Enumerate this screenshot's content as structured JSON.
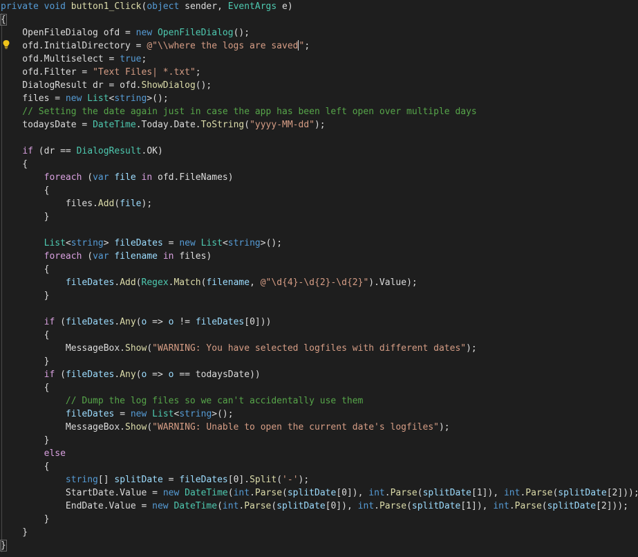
{
  "editor": {
    "lines": [
      [
        {
          "t": "private void ",
          "c": "kw"
        },
        {
          "t": "button1_Click",
          "c": "mth"
        },
        {
          "t": "(",
          "c": "txt"
        },
        {
          "t": "object",
          "c": "kw"
        },
        {
          "t": " sender, ",
          "c": "txt"
        },
        {
          "t": "EventArgs",
          "c": "type"
        },
        {
          "t": " e)",
          "c": "txt"
        }
      ],
      [
        {
          "t": "{",
          "c": "txt"
        }
      ],
      [
        {
          "t": "    OpenFileDialog ofd = ",
          "c": "txt"
        },
        {
          "t": "new",
          "c": "kw"
        },
        {
          "t": " ",
          "c": "txt"
        },
        {
          "t": "OpenFileDialog",
          "c": "type"
        },
        {
          "t": "();",
          "c": "txt"
        }
      ],
      [
        {
          "t": "    ofd.InitialDirectory = ",
          "c": "txt"
        },
        {
          "t": "@\"\\\\where the logs are saved",
          "c": "str"
        },
        {
          "t": "CARET",
          "c": "caret"
        },
        {
          "t": "\"",
          "c": "str"
        },
        {
          "t": ";",
          "c": "txt"
        }
      ],
      [
        {
          "t": "    ofd.Multiselect = ",
          "c": "txt"
        },
        {
          "t": "true",
          "c": "kw"
        },
        {
          "t": ";",
          "c": "txt"
        }
      ],
      [
        {
          "t": "    ofd.Filter = ",
          "c": "txt"
        },
        {
          "t": "\"Text Files| *.txt\"",
          "c": "str"
        },
        {
          "t": ";",
          "c": "txt"
        }
      ],
      [
        {
          "t": "    DialogResult dr = ofd.",
          "c": "txt"
        },
        {
          "t": "ShowDialog",
          "c": "mth"
        },
        {
          "t": "();",
          "c": "txt"
        }
      ],
      [
        {
          "t": "    files = ",
          "c": "txt"
        },
        {
          "t": "new",
          "c": "kw"
        },
        {
          "t": " ",
          "c": "txt"
        },
        {
          "t": "List",
          "c": "type"
        },
        {
          "t": "<",
          "c": "txt"
        },
        {
          "t": "string",
          "c": "kw"
        },
        {
          "t": ">();",
          "c": "txt"
        }
      ],
      [
        {
          "t": "    // Setting the date again just in case the app has been left open over multiple days",
          "c": "cmt"
        }
      ],
      [
        {
          "t": "    todaysDate = ",
          "c": "txt"
        },
        {
          "t": "DateTime",
          "c": "type"
        },
        {
          "t": ".Today.Date.",
          "c": "txt"
        },
        {
          "t": "ToString",
          "c": "mth"
        },
        {
          "t": "(",
          "c": "txt"
        },
        {
          "t": "\"yyyy-MM-dd\"",
          "c": "str"
        },
        {
          "t": ");",
          "c": "txt"
        }
      ],
      [],
      [
        {
          "t": "    ",
          "c": "txt"
        },
        {
          "t": "if",
          "c": "ctl"
        },
        {
          "t": " (dr == ",
          "c": "txt"
        },
        {
          "t": "DialogResult",
          "c": "type"
        },
        {
          "t": ".OK)",
          "c": "txt"
        }
      ],
      [
        {
          "t": "    {",
          "c": "txt"
        }
      ],
      [
        {
          "t": "        ",
          "c": "txt"
        },
        {
          "t": "foreach",
          "c": "ctl"
        },
        {
          "t": " (",
          "c": "txt"
        },
        {
          "t": "var",
          "c": "kw"
        },
        {
          "t": " ",
          "c": "txt"
        },
        {
          "t": "file",
          "c": "var"
        },
        {
          "t": " ",
          "c": "txt"
        },
        {
          "t": "in",
          "c": "ctl"
        },
        {
          "t": " ofd.FileNames)",
          "c": "txt"
        }
      ],
      [
        {
          "t": "        {",
          "c": "txt"
        }
      ],
      [
        {
          "t": "            files.",
          "c": "txt"
        },
        {
          "t": "Add",
          "c": "mth"
        },
        {
          "t": "(",
          "c": "txt"
        },
        {
          "t": "file",
          "c": "var"
        },
        {
          "t": ");",
          "c": "txt"
        }
      ],
      [
        {
          "t": "        }",
          "c": "txt"
        }
      ],
      [],
      [
        {
          "t": "        ",
          "c": "txt"
        },
        {
          "t": "List",
          "c": "type"
        },
        {
          "t": "<",
          "c": "txt"
        },
        {
          "t": "string",
          "c": "kw"
        },
        {
          "t": "> ",
          "c": "txt"
        },
        {
          "t": "fileDates",
          "c": "var"
        },
        {
          "t": " = ",
          "c": "txt"
        },
        {
          "t": "new",
          "c": "kw"
        },
        {
          "t": " ",
          "c": "txt"
        },
        {
          "t": "List",
          "c": "type"
        },
        {
          "t": "<",
          "c": "txt"
        },
        {
          "t": "string",
          "c": "kw"
        },
        {
          "t": ">();",
          "c": "txt"
        }
      ],
      [
        {
          "t": "        ",
          "c": "txt"
        },
        {
          "t": "foreach",
          "c": "ctl"
        },
        {
          "t": " (",
          "c": "txt"
        },
        {
          "t": "var",
          "c": "kw"
        },
        {
          "t": " ",
          "c": "txt"
        },
        {
          "t": "filename",
          "c": "var"
        },
        {
          "t": " ",
          "c": "txt"
        },
        {
          "t": "in",
          "c": "ctl"
        },
        {
          "t": " files)",
          "c": "txt"
        }
      ],
      [
        {
          "t": "        {",
          "c": "txt"
        }
      ],
      [
        {
          "t": "            ",
          "c": "txt"
        },
        {
          "t": "fileDates",
          "c": "var"
        },
        {
          "t": ".",
          "c": "txt"
        },
        {
          "t": "Add",
          "c": "mth"
        },
        {
          "t": "(",
          "c": "txt"
        },
        {
          "t": "Regex",
          "c": "type"
        },
        {
          "t": ".",
          "c": "txt"
        },
        {
          "t": "Match",
          "c": "mth"
        },
        {
          "t": "(",
          "c": "txt"
        },
        {
          "t": "filename",
          "c": "var"
        },
        {
          "t": ", ",
          "c": "txt"
        },
        {
          "t": "@\"\\d{4}-\\d{2}-\\d{2}\"",
          "c": "str"
        },
        {
          "t": ").Value);",
          "c": "txt"
        }
      ],
      [
        {
          "t": "        }",
          "c": "txt"
        }
      ],
      [],
      [
        {
          "t": "        ",
          "c": "txt"
        },
        {
          "t": "if",
          "c": "ctl"
        },
        {
          "t": " (",
          "c": "txt"
        },
        {
          "t": "fileDates",
          "c": "var"
        },
        {
          "t": ".",
          "c": "txt"
        },
        {
          "t": "Any",
          "c": "mth"
        },
        {
          "t": "(",
          "c": "txt"
        },
        {
          "t": "o",
          "c": "var"
        },
        {
          "t": " => ",
          "c": "txt"
        },
        {
          "t": "o",
          "c": "var"
        },
        {
          "t": " != ",
          "c": "txt"
        },
        {
          "t": "fileDates",
          "c": "var"
        },
        {
          "t": "[0]))",
          "c": "txt"
        }
      ],
      [
        {
          "t": "        {",
          "c": "txt"
        }
      ],
      [
        {
          "t": "            MessageBox.",
          "c": "txt"
        },
        {
          "t": "Show",
          "c": "mth"
        },
        {
          "t": "(",
          "c": "txt"
        },
        {
          "t": "\"WARNING: You have selected logfiles with different dates\"",
          "c": "str"
        },
        {
          "t": ");",
          "c": "txt"
        }
      ],
      [
        {
          "t": "        }",
          "c": "txt"
        }
      ],
      [
        {
          "t": "        ",
          "c": "txt"
        },
        {
          "t": "if",
          "c": "ctl"
        },
        {
          "t": " (",
          "c": "txt"
        },
        {
          "t": "fileDates",
          "c": "var"
        },
        {
          "t": ".",
          "c": "txt"
        },
        {
          "t": "Any",
          "c": "mth"
        },
        {
          "t": "(",
          "c": "txt"
        },
        {
          "t": "o",
          "c": "var"
        },
        {
          "t": " => ",
          "c": "txt"
        },
        {
          "t": "o",
          "c": "var"
        },
        {
          "t": " == todaysDate))",
          "c": "txt"
        }
      ],
      [
        {
          "t": "        {",
          "c": "txt"
        }
      ],
      [
        {
          "t": "            // Dump the log files so we can't accidentally use them",
          "c": "cmt"
        }
      ],
      [
        {
          "t": "            ",
          "c": "txt"
        },
        {
          "t": "fileDates",
          "c": "var"
        },
        {
          "t": " = ",
          "c": "txt"
        },
        {
          "t": "new",
          "c": "kw"
        },
        {
          "t": " ",
          "c": "txt"
        },
        {
          "t": "List",
          "c": "type"
        },
        {
          "t": "<",
          "c": "txt"
        },
        {
          "t": "string",
          "c": "kw"
        },
        {
          "t": ">();",
          "c": "txt"
        }
      ],
      [
        {
          "t": "            MessageBox.",
          "c": "txt"
        },
        {
          "t": "Show",
          "c": "mth"
        },
        {
          "t": "(",
          "c": "txt"
        },
        {
          "t": "\"WARNING: Unable to open the current date's logfiles\"",
          "c": "str"
        },
        {
          "t": ");",
          "c": "txt"
        }
      ],
      [
        {
          "t": "        }",
          "c": "txt"
        }
      ],
      [
        {
          "t": "        ",
          "c": "txt"
        },
        {
          "t": "else",
          "c": "ctl"
        }
      ],
      [
        {
          "t": "        {",
          "c": "txt"
        }
      ],
      [
        {
          "t": "            ",
          "c": "txt"
        },
        {
          "t": "string",
          "c": "kw"
        },
        {
          "t": "[] ",
          "c": "txt"
        },
        {
          "t": "splitDate",
          "c": "var"
        },
        {
          "t": " = ",
          "c": "txt"
        },
        {
          "t": "fileDates",
          "c": "var"
        },
        {
          "t": "[0].",
          "c": "txt"
        },
        {
          "t": "Split",
          "c": "mth"
        },
        {
          "t": "(",
          "c": "txt"
        },
        {
          "t": "'-'",
          "c": "str"
        },
        {
          "t": ");",
          "c": "txt"
        }
      ],
      [
        {
          "t": "            StartDate.Value = ",
          "c": "txt"
        },
        {
          "t": "new",
          "c": "kw"
        },
        {
          "t": " ",
          "c": "txt"
        },
        {
          "t": "DateTime",
          "c": "type"
        },
        {
          "t": "(",
          "c": "txt"
        },
        {
          "t": "int",
          "c": "kw"
        },
        {
          "t": ".",
          "c": "txt"
        },
        {
          "t": "Parse",
          "c": "mth"
        },
        {
          "t": "(",
          "c": "txt"
        },
        {
          "t": "splitDate",
          "c": "var"
        },
        {
          "t": "[0]), ",
          "c": "txt"
        },
        {
          "t": "int",
          "c": "kw"
        },
        {
          "t": ".",
          "c": "txt"
        },
        {
          "t": "Parse",
          "c": "mth"
        },
        {
          "t": "(",
          "c": "txt"
        },
        {
          "t": "splitDate",
          "c": "var"
        },
        {
          "t": "[1]), ",
          "c": "txt"
        },
        {
          "t": "int",
          "c": "kw"
        },
        {
          "t": ".",
          "c": "txt"
        },
        {
          "t": "Parse",
          "c": "mth"
        },
        {
          "t": "(",
          "c": "txt"
        },
        {
          "t": "splitDate",
          "c": "var"
        },
        {
          "t": "[2]));",
          "c": "txt"
        }
      ],
      [
        {
          "t": "            EndDate.Value = ",
          "c": "txt"
        },
        {
          "t": "new",
          "c": "kw"
        },
        {
          "t": " ",
          "c": "txt"
        },
        {
          "t": "DateTime",
          "c": "type"
        },
        {
          "t": "(",
          "c": "txt"
        },
        {
          "t": "int",
          "c": "kw"
        },
        {
          "t": ".",
          "c": "txt"
        },
        {
          "t": "Parse",
          "c": "mth"
        },
        {
          "t": "(",
          "c": "txt"
        },
        {
          "t": "splitDate",
          "c": "var"
        },
        {
          "t": "[0]), ",
          "c": "txt"
        },
        {
          "t": "int",
          "c": "kw"
        },
        {
          "t": ".",
          "c": "txt"
        },
        {
          "t": "Parse",
          "c": "mth"
        },
        {
          "t": "(",
          "c": "txt"
        },
        {
          "t": "splitDate",
          "c": "var"
        },
        {
          "t": "[1]), ",
          "c": "txt"
        },
        {
          "t": "int",
          "c": "kw"
        },
        {
          "t": ".",
          "c": "txt"
        },
        {
          "t": "Parse",
          "c": "mth"
        },
        {
          "t": "(",
          "c": "txt"
        },
        {
          "t": "splitDate",
          "c": "var"
        },
        {
          "t": "[2]));",
          "c": "txt"
        }
      ],
      [
        {
          "t": "        }",
          "c": "txt"
        }
      ],
      [
        {
          "t": "    }",
          "c": "txt"
        }
      ],
      [
        {
          "t": "}",
          "c": "txt"
        }
      ]
    ]
  },
  "colors": {
    "background": "#1e1e1e",
    "keyword": "#569cd6",
    "control": "#d8a0df",
    "type": "#4ec9b0",
    "string": "#d69d85",
    "comment": "#57a64a",
    "method": "#dcdcaa",
    "variable": "#9cdcfe",
    "text": "#dcdcdc"
  },
  "icons": {
    "gutter": "lightbulb-icon"
  }
}
